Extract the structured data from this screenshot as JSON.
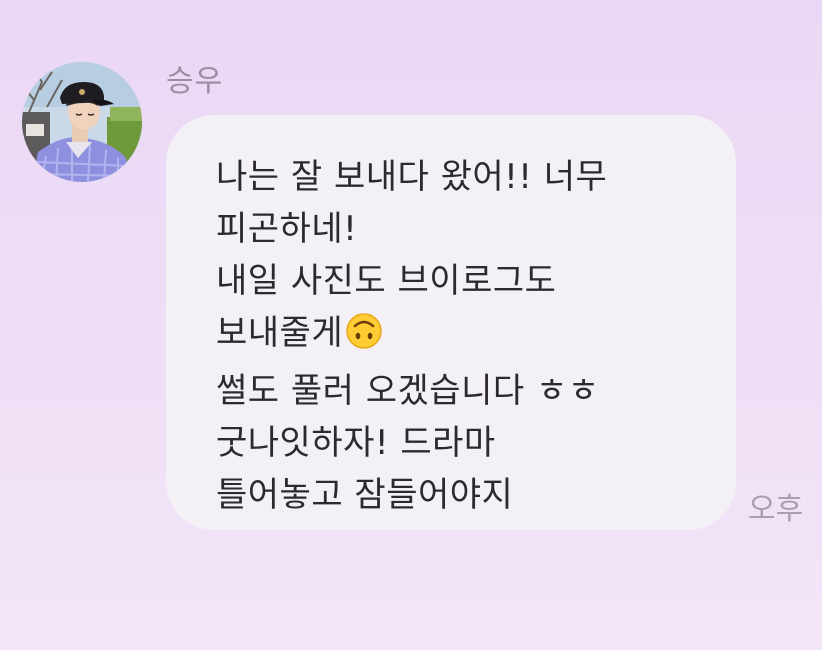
{
  "sender": {
    "name": "승우"
  },
  "message": {
    "lines": [
      "나는 잘 보내다 왔어!! 너무",
      "피곤하네!",
      "내일 사진도 브이로그도",
      "보내줄게",
      "썰도 풀러 오겠습니다 ㅎㅎ",
      "굿나잇하자! 드라마",
      "틀어놓고 잠들어야지"
    ],
    "emoji": "upside-down-face-icon"
  },
  "timestamp": "오후",
  "colors": {
    "background": "#ecdcf6",
    "bubble": "#f3f1f5",
    "text": "#2d2a2f",
    "muted": "#9a8da3"
  }
}
